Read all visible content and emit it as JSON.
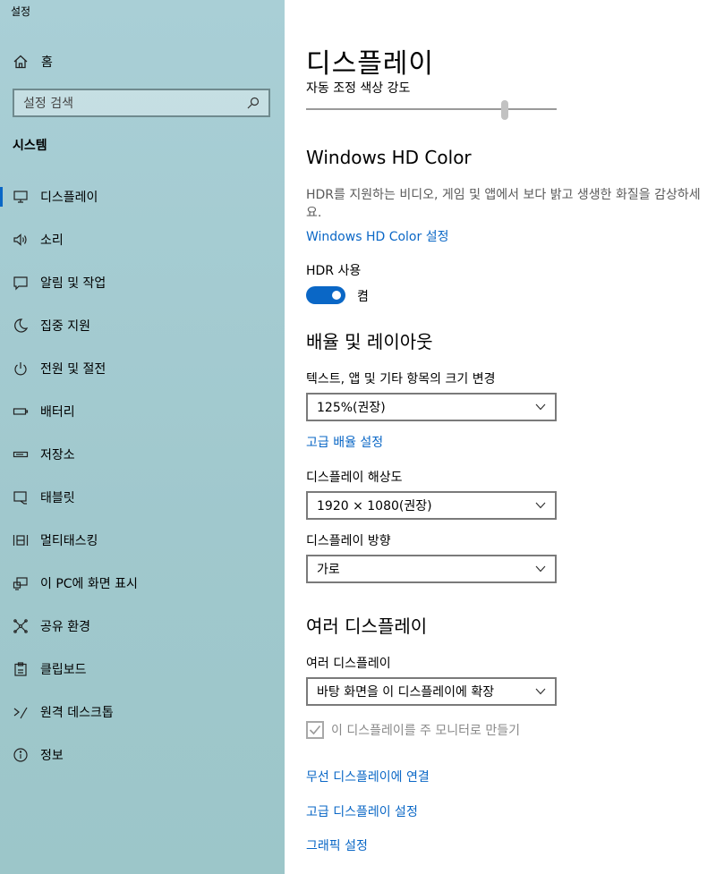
{
  "app": {
    "title": "설정"
  },
  "sidebar": {
    "home_label": "홈",
    "search_placeholder": "설정 검색",
    "section_label": "시스템",
    "items": [
      {
        "label": "디스플레이",
        "icon": "monitor-icon",
        "active": true
      },
      {
        "label": "소리",
        "icon": "speaker-icon"
      },
      {
        "label": "알림 및 작업",
        "icon": "notification-icon"
      },
      {
        "label": "집중 지원",
        "icon": "moon-icon"
      },
      {
        "label": "전원 및 절전",
        "icon": "power-icon"
      },
      {
        "label": "배터리",
        "icon": "battery-icon"
      },
      {
        "label": "저장소",
        "icon": "storage-icon"
      },
      {
        "label": "태블릿",
        "icon": "tablet-icon"
      },
      {
        "label": "멀티태스킹",
        "icon": "multitasking-icon"
      },
      {
        "label": "이 PC에 화면 표시",
        "icon": "project-icon"
      },
      {
        "label": "공유 환경",
        "icon": "shared-experiences-icon"
      },
      {
        "label": "클립보드",
        "icon": "clipboard-icon"
      },
      {
        "label": "원격 데스크톱",
        "icon": "remote-desktop-icon"
      },
      {
        "label": "정보",
        "icon": "info-icon"
      }
    ]
  },
  "main": {
    "page_title": "디스플레이",
    "brightness_label": "자동 조정 색상 강도",
    "brightness_level": 0.8,
    "hd_color": {
      "heading": "Windows HD Color",
      "description": "HDR를 지원하는 비디오, 게임 및 앱에서 보다 밝고 생생한 화질을 감상하세요.",
      "link": "Windows HD Color 설정",
      "hdr_label": "HDR 사용",
      "hdr_state": "켬"
    },
    "scale_layout": {
      "heading": "배율 및 레이아웃",
      "scale_label": "텍스트, 앱 및 기타 항목의 크기 변경",
      "scale_value": "125%(권장)",
      "advanced_link": "고급 배율 설정",
      "resolution_label": "디스플레이 해상도",
      "resolution_value": "1920 × 1080(권장)",
      "orientation_label": "디스플레이 방향",
      "orientation_value": "가로"
    },
    "multi_display": {
      "heading": "여러 디스플레이",
      "label": "여러 디스플레이",
      "value": "바탕 화면을 이 디스플레이에 확장",
      "primary_checkbox": "이 디스플레이를 주 모니터로 만들기",
      "links": [
        "무선 디스플레이에 연결",
        "고급 디스플레이 설정",
        "그래픽 설정"
      ]
    },
    "accent_color": "#0a67c6"
  }
}
